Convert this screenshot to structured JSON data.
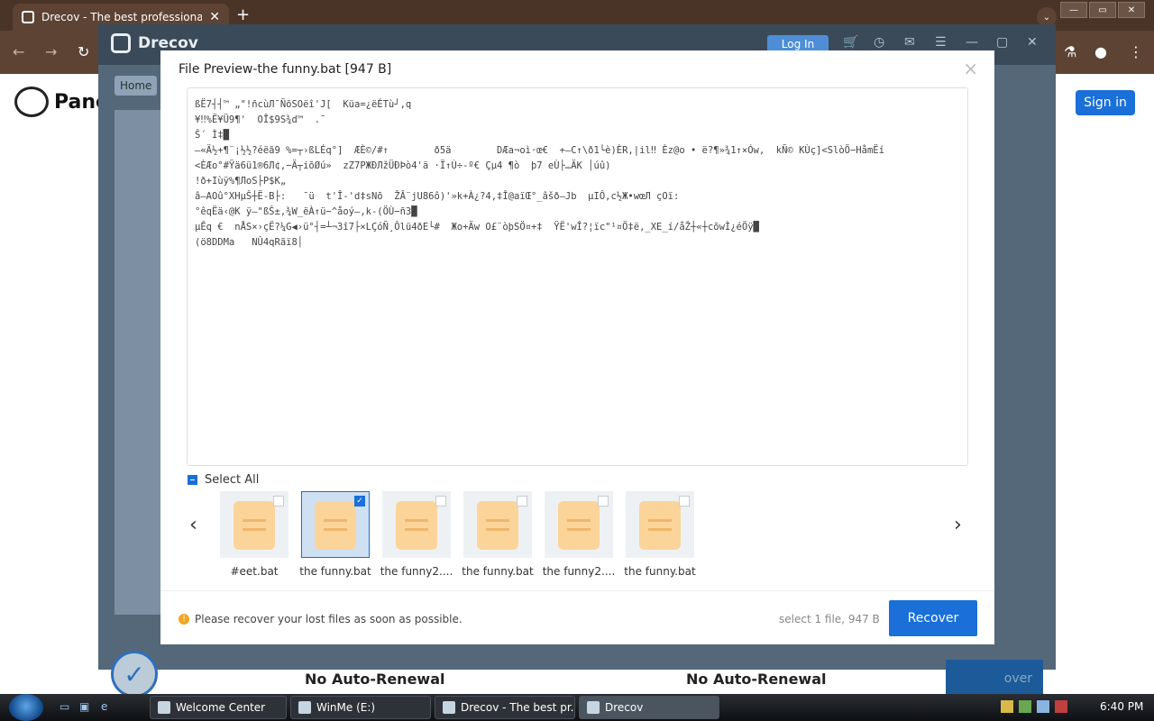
{
  "browser": {
    "tab_title": "Drecov - The best professional",
    "tab_close": "✕",
    "new_tab": "+",
    "nav": {
      "back": "←",
      "forward": "→",
      "reload": "↻"
    },
    "right_icons": {
      "labs": "⚗",
      "profile": "●",
      "menu": "⋮"
    },
    "tab_menu": "⌄",
    "win": {
      "min": "—",
      "max": "▭",
      "close": "✕"
    }
  },
  "website": {
    "logo_text": "Panc",
    "sign_in": "Sign in",
    "plans": [
      "No Auto-Renewal",
      "No Auto-Renewal"
    ]
  },
  "app": {
    "name": "Drecov",
    "login": "Log In",
    "header_icons": [
      "cart-icon",
      "history-icon",
      "mail-icon",
      "menu-icon",
      "minimize-icon",
      "maximize-icon",
      "close-icon"
    ],
    "home_crumb": "Home",
    "background_recover": "over"
  },
  "modal": {
    "title": "File Preview-the funny.bat [947 B]",
    "close": "×",
    "preview_lines": [
      "ßË7┤┤™ „\"!ñcùЛ¯ÑõSOëî'J[  Küa=¿ëÉTù┘‚q",
      "¥‼%Ë¥Ü9¶'  OÎ$9S¾d™  .¯",
      "Š´ Ì‡█",
      "–«Ä½+¶¨¡½½?éëã9 %=┬›ßLÉq°]  ÆÈ©/#↑        ð5ä        DÆa¬oì·œ€  +—C↑\\ð1└è)ÈR,|il‼ Èz@o • ë?¶»¾1↑×Ów,  kÑ© KÙç]<SlòÖ−HåmËí",
      "<ÈÆo°#Ÿä6ü1®6Л¢,−Ä┬iõØú»  zZ7PЖÐЛžÜÐÞò4'ä ·Ï↑Ù÷-º€ Çµ4 ¶ò  þ7 eÙ├…ÄK │úû)",
      "!ð+Iùÿ%¶ЛoS├P$K„",
      "â—AOû°XHµŠ┼Ë-B├:   ¯ü  t'Î-'d‡sNõ  ŽÂ¨jU86ô)'»k+À¿?4,‡Î@aïŒ°_âšð–Jb  µIÔ,c½Ж•wœЛ çOï:",
      "°êqËä‹@K ÿ–\"ßŠ±,¾W_ëÀ↑ü−^åoý–,k-(ÖÙ−ñ3█",
      "µÊq €  nÅS×›çË?¼G◀›ü°┤=┴¬3î7├×LÇóÑ¸Ôlü4ðE└#  Жo+Äw O£¨òþSÖ¤+‡  ŸË'wÎ?¦ïc\"¹¤Ö‡ë,_XE_í/åŽ┼«┼cõwÌ¿éÖÿ█",
      "(ö8DDMa   NÛ4qRãï8│"
    ],
    "select_all": "Select All",
    "files": [
      "#eet.bat",
      "the funny.bat",
      "the funny2....",
      "the funny.bat",
      "the funny2....",
      "the funny.bat"
    ],
    "selected_index": 1,
    "warning": "Please recover your lost files as soon as possible.",
    "select_info": "select 1 file, 947 B",
    "recover": "Recover",
    "prev": "‹",
    "next": "›"
  },
  "taskbar": {
    "buttons": [
      "Welcome Center",
      "WinMe (E:)",
      "Drecov - The best pr...",
      "Drecov"
    ],
    "clock": "6:40 PM"
  }
}
